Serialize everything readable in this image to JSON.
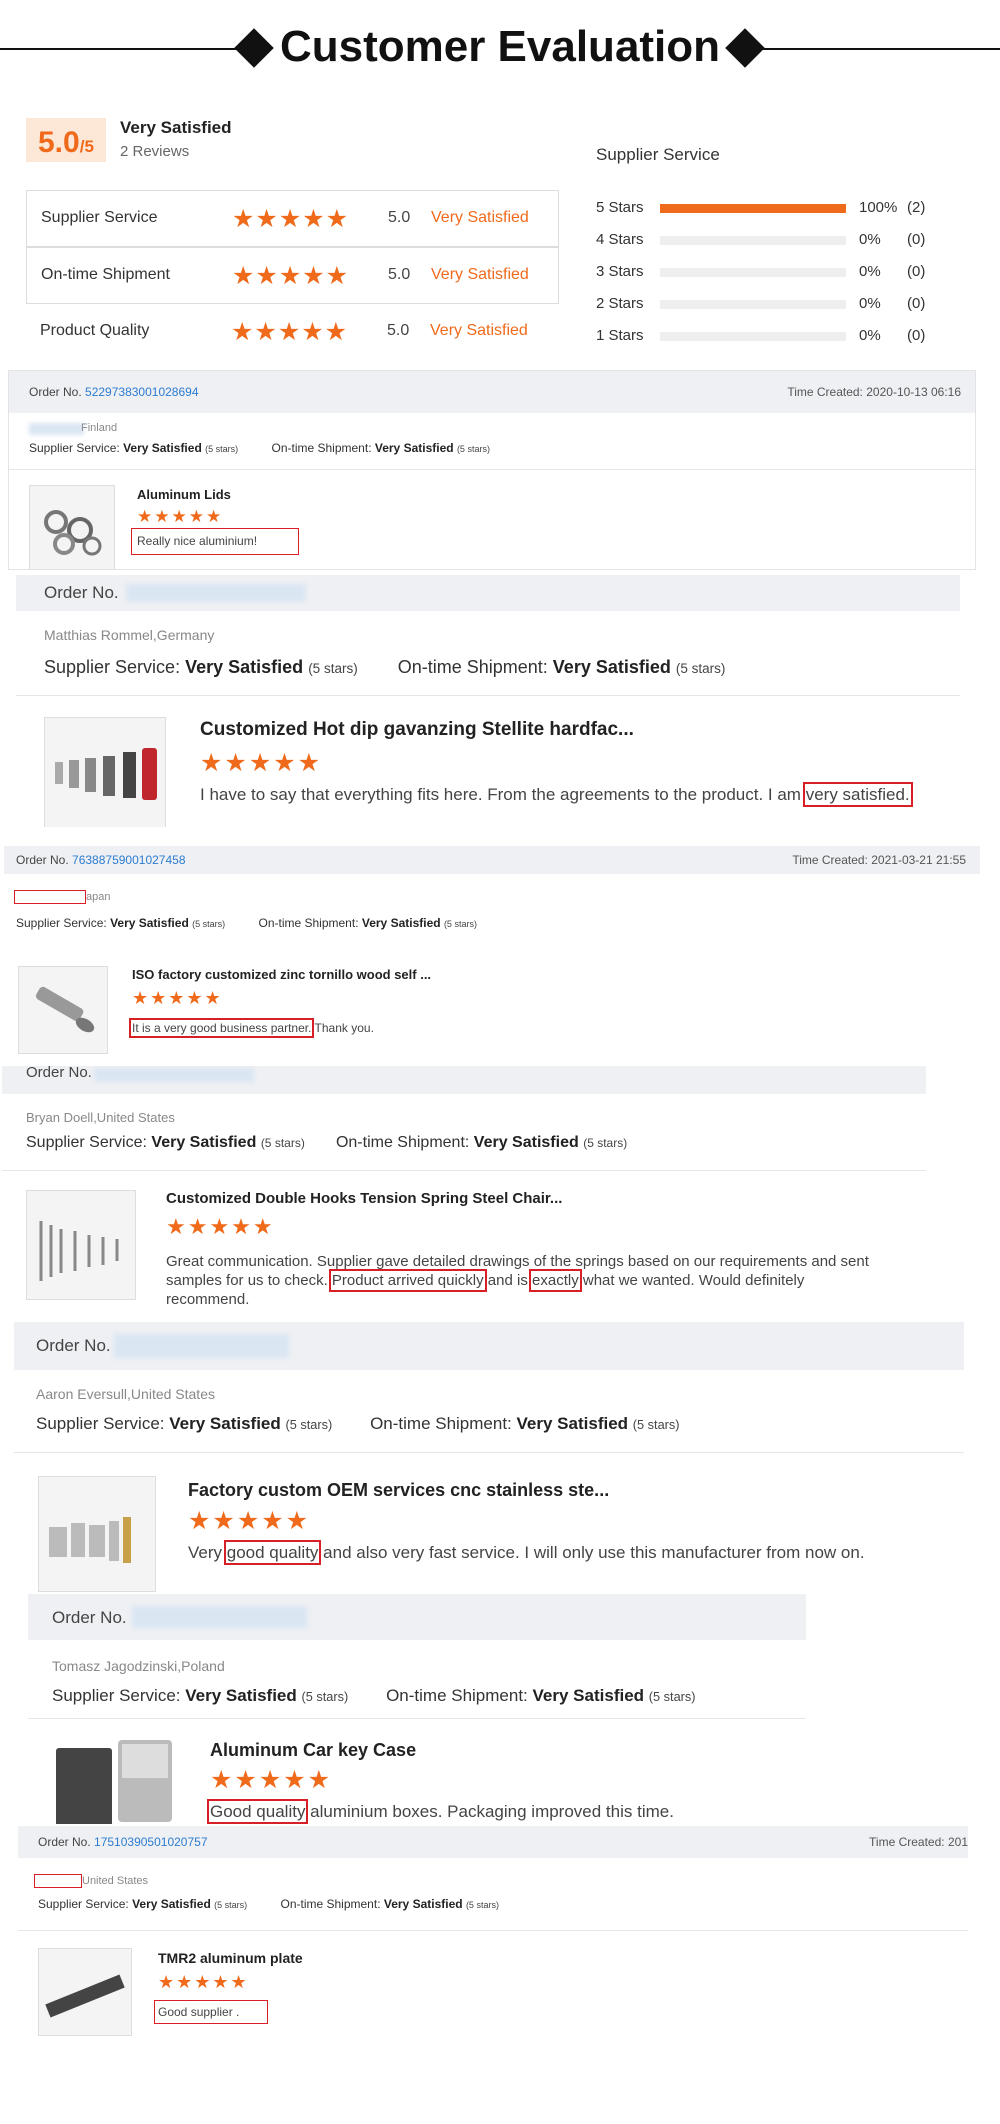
{
  "header": {
    "title": "Customer Evaluation"
  },
  "summary": {
    "score": "5.0",
    "score_max": "/5",
    "label": "Very Satisfied",
    "reviews": "2 Reviews",
    "ratings": [
      {
        "label": "Supplier Service",
        "stars": "★★★★★",
        "value": "5.0",
        "verdict": "Very Satisfied"
      },
      {
        "label": "On-time Shipment",
        "stars": "★★★★★",
        "value": "5.0",
        "verdict": "Very Satisfied"
      },
      {
        "label": "Product Quality",
        "stars": "★★★★★",
        "value": "5.0",
        "verdict": "Very Satisfied"
      }
    ],
    "distribution_title": "Supplier Service",
    "distribution": [
      {
        "label": "5 Stars",
        "fraction": 1.0,
        "pct": "100%",
        "count": "(2)"
      },
      {
        "label": "4 Stars",
        "fraction": 0,
        "pct": "0%",
        "count": "(0)"
      },
      {
        "label": "3 Stars",
        "fraction": 0,
        "pct": "0%",
        "count": "(0)"
      },
      {
        "label": "2 Stars",
        "fraction": 0,
        "pct": "0%",
        "count": "(0)"
      },
      {
        "label": "1 Stars",
        "fraction": 0,
        "pct": "0%",
        "count": "(0)"
      }
    ]
  },
  "common": {
    "order_label": "Order No.",
    "time_label": "Time Created:",
    "supplier_service_label": "Supplier Service:",
    "shipment_label": "On-time Shipment:",
    "very_satisfied": "Very Satisfied",
    "five_stars": "(5 stars)",
    "stars": "★★★★★"
  },
  "reviews": [
    {
      "order_no": "52297383001028694",
      "time": "2020-10-13 06:16",
      "reviewer": "Finland",
      "product": "Aluminum Lids",
      "comment": "Really nice aluminium!"
    },
    {
      "order_no": "",
      "time": "",
      "reviewer": "Matthias Rommel,Germany",
      "product": "Customized Hot dip gavanzing Stellite hardfac...",
      "comment_a": "I have to say that everything fits here. From the agreements to the product. I am ",
      "comment_b": "very satisfied."
    },
    {
      "order_no": "76388759001027458",
      "time": "2021-03-21 21:55",
      "reviewer": "apan",
      "product": "ISO factory customized zinc tornillo wood self ...",
      "comment_a": "It is a very good business partner.",
      "comment_b": " Thank you."
    },
    {
      "order_no": "",
      "time": "",
      "reviewer": "Bryan Doell,United States",
      "product": "Customized Double Hooks Tension Spring Steel Chair...",
      "comment_a": "Great communication. Supplier gave detailed drawings of the springs based on our requirements and sent samples for us to check. ",
      "comment_b": "Product arrived quickly",
      "comment_c": " and is ",
      "comment_d": "exactly",
      "comment_e": " what we wanted. Would definitely recommend."
    },
    {
      "order_no": "",
      "time": "",
      "reviewer": "Aaron Eversull,United States",
      "product": "Factory custom OEM services cnc stainless ste...",
      "comment_a": "Very ",
      "comment_b": "good quality",
      "comment_c": " and also very fast service. I will only use this manufacturer from now on."
    },
    {
      "order_no": "",
      "time": "",
      "reviewer": "Tomasz Jagodzinski,Poland",
      "product": "Aluminum Car key Case",
      "comment_a": "Good quality",
      "comment_b": " aluminium boxes. Packaging improved this time."
    },
    {
      "order_no": "17510390501020757",
      "time": "201",
      "reviewer": "United States",
      "product": "TMR2 aluminum plate",
      "comment": "Good supplier ."
    }
  ]
}
